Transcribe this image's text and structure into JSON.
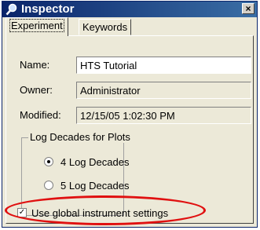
{
  "window": {
    "title": "Inspector",
    "close_glyph": "×"
  },
  "tabs": [
    {
      "label": "Experiment"
    },
    {
      "label": "Keywords"
    }
  ],
  "fields": {
    "name": {
      "label": "Name:",
      "value": "HTS Tutorial"
    },
    "owner": {
      "label": "Owner:",
      "value": "Administrator"
    },
    "modified": {
      "label": "Modified:",
      "value": "12/15/05 1:02:30 PM"
    }
  },
  "log_decades": {
    "title": "Log Decades for Plots",
    "options": [
      {
        "label": "4 Log Decades",
        "selected": true
      },
      {
        "label": "5 Log Decades",
        "selected": false
      }
    ]
  },
  "global_settings": {
    "label": "Use global instrument settings",
    "checked": true
  },
  "icons": {
    "title": "inspector-magnifier-icon"
  },
  "colors": {
    "titlebar": "#0a246a",
    "highlight": "#e01010"
  }
}
